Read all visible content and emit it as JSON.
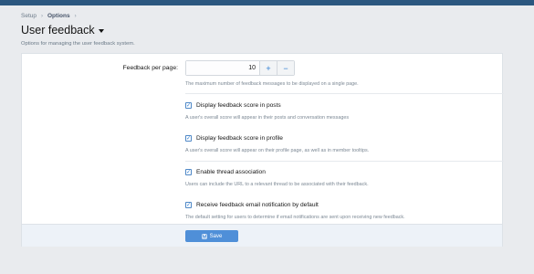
{
  "breadcrumb": {
    "items": [
      "Setup",
      "Options"
    ]
  },
  "header": {
    "title": "User feedback",
    "description": "Options for managing the user feedback system."
  },
  "options": {
    "per_page": {
      "label": "Feedback per page:",
      "value": "10",
      "explain": "The maximum number of feedback messages to be displayed on a single page."
    },
    "score_posts": {
      "label": "Display feedback score in posts",
      "explain": "A user's overall score will appear in their posts and conversation messages",
      "checked": true
    },
    "score_profile": {
      "label": "Display feedback score in profile",
      "explain": "A user's overall score will appear on their profile page, as well as in member tooltips.",
      "checked": true
    },
    "thread_assoc": {
      "label": "Enable thread association",
      "explain": "Users can include the URL to a relevant thread to be associated with their feedback.",
      "checked": true
    },
    "email_notify": {
      "label": "Receive feedback email notification by default",
      "explain": "The default setting for users to determine if email notifications are sent upon receiving new feedback.",
      "checked": true
    }
  },
  "footer": {
    "save_label": "Save"
  },
  "colors": {
    "accent": "#2b7cd3",
    "topbar": "#2b577f",
    "button": "#4f8fd8"
  }
}
